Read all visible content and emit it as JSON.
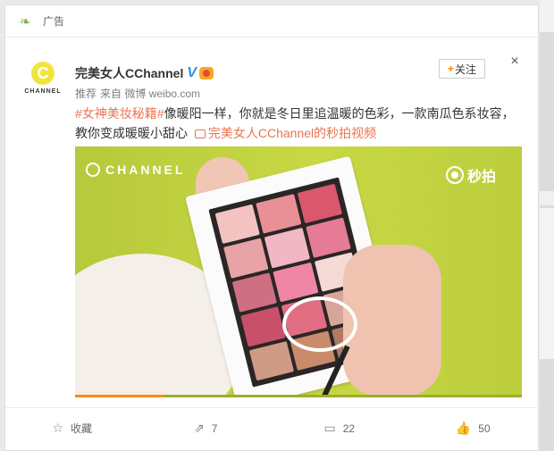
{
  "ad_label": "广告",
  "post": {
    "author": "完美女人CChannel",
    "verified_badge": "V",
    "meta": [
      "推荐",
      "来自 微博 weibo.com"
    ],
    "follow_label": "关注",
    "close_label": "×",
    "avatar_text": "CHANNEL",
    "avatar_letter": "C",
    "text": {
      "tag": "#女神美妆秘籍#",
      "body": "像暖阳一样，你就是冬日里追温暖的色彩，一款南瓜色系妆容，教你变成暖暖小甜心",
      "link": "完美女人CChannel的秒拍视频"
    },
    "video": {
      "watermark_left": "CHANNEL",
      "watermark_right": "秒拍",
      "progress": 0.2
    }
  },
  "actions": [
    {
      "icon": "star-icon",
      "label": "收藏"
    },
    {
      "icon": "share-icon",
      "label": "7"
    },
    {
      "icon": "comment-icon",
      "label": "22"
    },
    {
      "icon": "like-icon",
      "label": "50"
    }
  ],
  "colors": {
    "tag": "#eb7350",
    "accent": "#ff8200",
    "video_bg": "#c3d442",
    "link_verified": "#2e8ee6"
  }
}
